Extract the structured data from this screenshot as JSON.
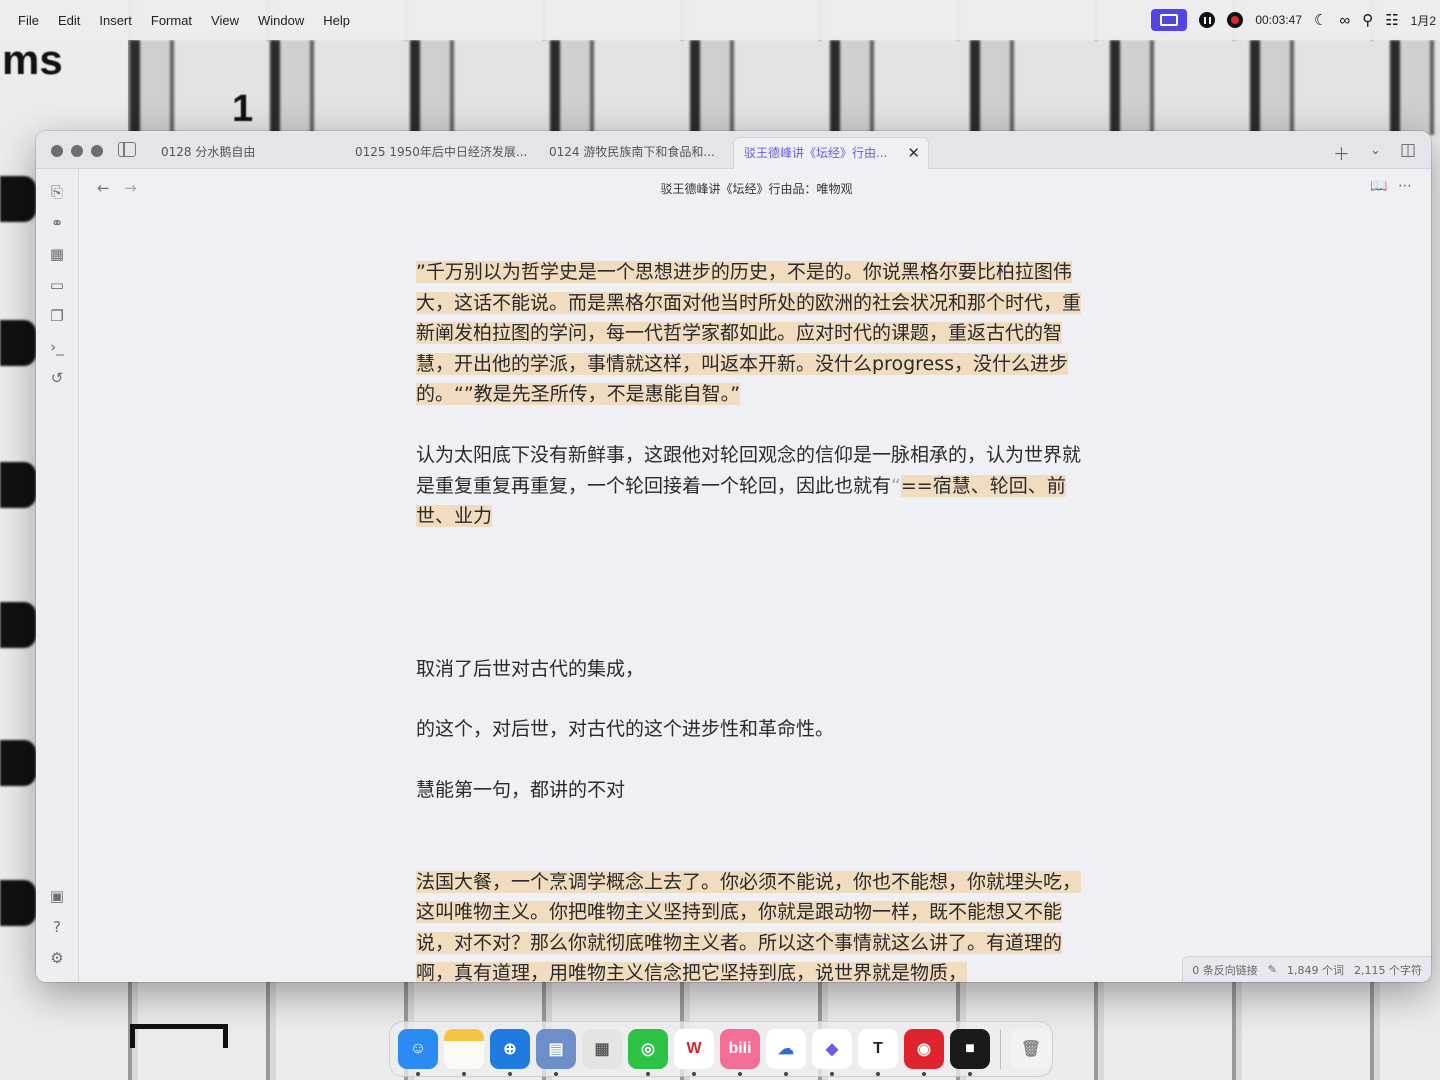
{
  "menubar": {
    "items": [
      "File",
      "Edit",
      "Insert",
      "Format",
      "View",
      "Window",
      "Help"
    ],
    "status": {
      "timer": "00:03:47",
      "date": "1月2"
    }
  },
  "background": {
    "labels": [
      "ms",
      "1"
    ]
  },
  "window": {
    "tabs": [
      {
        "label": "0128 分水鹅自由"
      },
      {
        "label": "0125 1950年后中日经济发展..."
      },
      {
        "label": "0124 游牧民族南下和食品和..."
      },
      {
        "label": "驳王德峰讲《坛经》行由..."
      }
    ],
    "note_title": "驳王德峰讲《坛经》行由品：唯物观",
    "content": {
      "p1": "”千万别以为哲学史是一个思想进步的历史，不是的。你说黑格尔要比柏拉图伟大，这话不能说。而是黑格尔面对他当时所处的欧洲的社会状况和那个时代，重新阐发柏拉图的学问，每一代哲学家都如此。应对时代的课题，重返古代的智慧，开出他的学派，事情就这样，叫返本开新。没什么progress，没什么进步的。“”教是先圣所传，不是惠能自智。”",
      "p2_plain": "认为太阳底下没有新鲜事，这跟他对轮回观念的信仰是一脉相承的，认为世界就是重复重复再重复，一个轮回接着一个轮回，因此也就有",
      "p2_mark": "“",
      "p2_hl": "==宿慧、轮回、前世、业力",
      "p3": "取消了后世对古代的集成，",
      "p4": "的这个，对后世，对古代的这个进步性和革命性。",
      "p5": "慧能第一句，都讲的不对",
      "p6": "法国大餐，一个烹调学概念上去了。你必须不能说，你也不能想，你就埋头吃，这叫唯物主义。你把唯物主义坚持到底，你就是跟动物一样，既不能想又不能说，对不对？那么你就彻底唯物主义者。所以这个事情就这么讲了。有道理的啊，真有道理，用唯物主义信念把它坚持到底，说世界就是物质，"
    },
    "status": {
      "backlinks": "0 条反向链接",
      "words": "1,849 个词",
      "chars": "2,115 个字符"
    }
  },
  "dock": {
    "apps": [
      {
        "name": "finder",
        "glyph": "☺",
        "color": "#2a8cf3"
      },
      {
        "name": "notes",
        "glyph": "",
        "color": "#f4c542"
      },
      {
        "name": "safari",
        "glyph": "⊕",
        "color": "#1f7be0"
      },
      {
        "name": "preview",
        "glyph": "▤",
        "color": "#6c8fc9"
      },
      {
        "name": "launchpad",
        "glyph": "▦",
        "color": "#e4e4e6"
      },
      {
        "name": "wechat",
        "glyph": "◎",
        "color": "#2ec245"
      },
      {
        "name": "wps",
        "glyph": "W",
        "color": "#ffffff"
      },
      {
        "name": "bilibili",
        "glyph": "bili",
        "color": "#f36f97"
      },
      {
        "name": "cloud-drive",
        "glyph": "☁",
        "color": "#ffffff"
      },
      {
        "name": "obsidian",
        "glyph": "◆",
        "color": "#ffffff"
      },
      {
        "name": "typora",
        "glyph": "T",
        "color": "#ffffff"
      },
      {
        "name": "netease-music",
        "glyph": "◉",
        "color": "#e0242e"
      },
      {
        "name": "rec-camera",
        "glyph": "■",
        "color": "#1a1a1a"
      },
      {
        "name": "trash",
        "glyph": "🗑",
        "color": "#f2f2f2"
      }
    ]
  }
}
